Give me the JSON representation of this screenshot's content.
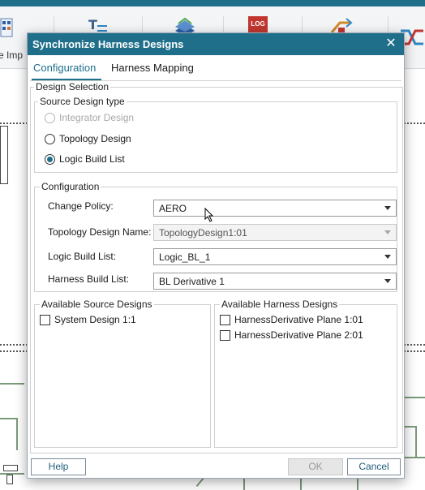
{
  "background": {
    "ribbon_label_partial": "e Imp",
    "log_icon_text": "LOG"
  },
  "dialog": {
    "title": "Synchronize Harness Designs",
    "tabs": [
      {
        "label": "Configuration",
        "active": true
      },
      {
        "label": "Harness Mapping",
        "active": false
      }
    ],
    "design_selection": {
      "legend": "Design Selection",
      "source_type_legend": "Source Design type",
      "options": [
        {
          "label": "Integrator Design",
          "checked": false,
          "disabled": true
        },
        {
          "label": "Topology Design",
          "checked": false,
          "disabled": false
        },
        {
          "label": "Logic Build List",
          "checked": true,
          "disabled": false
        }
      ]
    },
    "configuration": {
      "legend": "Configuration",
      "fields": [
        {
          "label": "Change Policy:",
          "value": "AERO",
          "disabled": false
        },
        {
          "label": "Topology Design Name:",
          "value": "TopologyDesign1:01",
          "disabled": true
        },
        {
          "label": "Logic Build List:",
          "value": "Logic_BL_1",
          "disabled": false
        },
        {
          "label": "Harness Build List:",
          "value": "BL Derivative 1",
          "disabled": false
        }
      ]
    },
    "available_source": {
      "legend": "Available Source Designs",
      "items": [
        {
          "label": "System Design 1:1",
          "checked": false
        }
      ]
    },
    "available_harness": {
      "legend": "Available Harness Designs",
      "items": [
        {
          "label": "HarnessDerivative Plane 1:01",
          "checked": false
        },
        {
          "label": "HarnessDerivative Plane 2:01",
          "checked": false
        }
      ]
    },
    "buttons": {
      "help": "Help",
      "ok": "OK",
      "cancel": "Cancel"
    }
  },
  "colors": {
    "accent": "#1f6f8b",
    "wire": "#7a9a7a"
  }
}
